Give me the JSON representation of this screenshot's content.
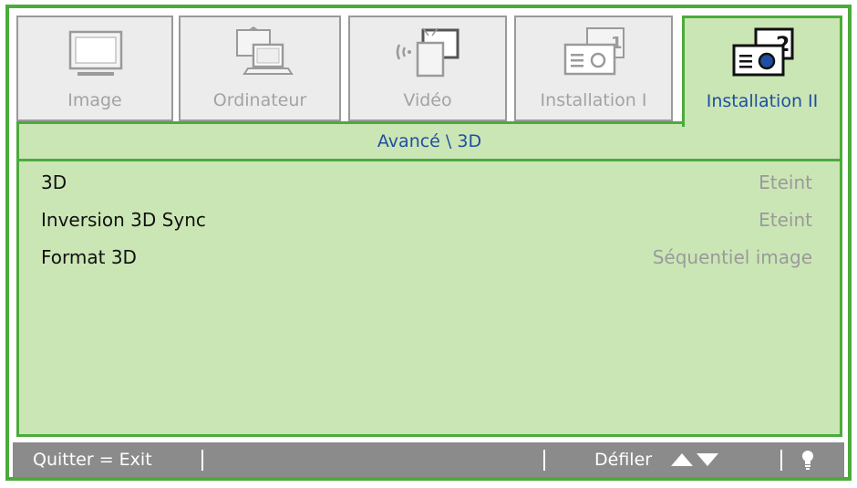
{
  "tabs": [
    {
      "label": "Image",
      "icon": "monitor-icon",
      "active": false
    },
    {
      "label": "Ordinateur",
      "icon": "computer-icon",
      "active": false
    },
    {
      "label": "Vidéo",
      "icon": "video-icon",
      "active": false
    },
    {
      "label": "Installation I",
      "icon": "projector-1-icon",
      "active": false
    },
    {
      "label": "Installation II",
      "icon": "projector-2-icon",
      "active": true
    }
  ],
  "panel": {
    "title": "Avancé \\ 3D",
    "rows": [
      {
        "label": "3D",
        "value": "Eteint"
      },
      {
        "label": "Inversion 3D Sync",
        "value": "Eteint"
      },
      {
        "label": "Format 3D",
        "value": "Séquentiel image"
      }
    ]
  },
  "footer": {
    "exit": "Quitter = Exit",
    "scroll": "Défiler",
    "scroll_icon": "up-down-arrows-icon",
    "help_icon": "lightbulb-icon"
  },
  "colors": {
    "border_green": "#4caa3c",
    "panel_bg": "#cbe6b5",
    "accent_text": "#1f4fa0",
    "footer_bg": "#8b8b8b"
  }
}
